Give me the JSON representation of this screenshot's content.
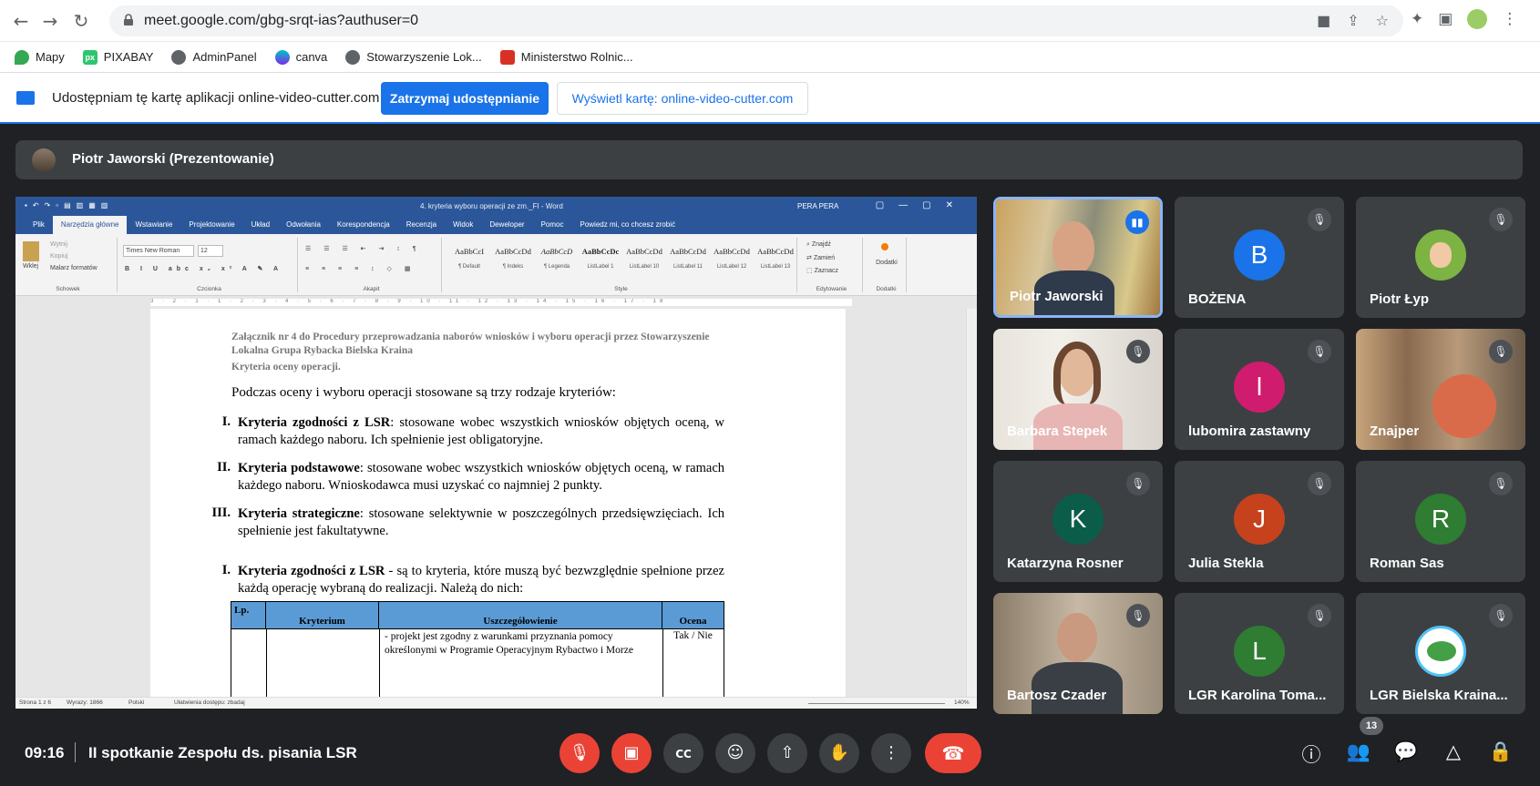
{
  "browser": {
    "url": "meet.google.com/gbg-srqt-ias?authuser=0",
    "bookmarks": [
      {
        "label": "Mapy",
        "color": "#34a853"
      },
      {
        "label": "PIXABAY",
        "color": "#2ec66d",
        "icon_text": "px"
      },
      {
        "label": "AdminPanel",
        "color": "#5f6368"
      },
      {
        "label": "canva",
        "color": "#7d2ae8"
      },
      {
        "label": "Stowarzyszenie Lok...",
        "color": "#5f6368"
      },
      {
        "label": "Ministerstwo Rolnic...",
        "color": "#d93025"
      }
    ]
  },
  "share_bar": {
    "text": "Udostępniam tę kartę aplikacji online-video-cutter.com",
    "stop_label": "Zatrzymaj udostępnianie",
    "show_label": "Wyświetl kartę: online-video-cutter.com"
  },
  "presenter": {
    "name": "Piotr Jaworski (Prezentowanie)"
  },
  "word": {
    "doc_title": "4. kryteria wyboru operacji ze zm._FI  -  Word",
    "user": "PERA PERA",
    "tabs": [
      "Plik",
      "Narzędzia główne",
      "Wstawianie",
      "Projektowanie",
      "Układ",
      "Odwołania",
      "Korespondencja",
      "Recenzja",
      "Widok",
      "Deweloper",
      "Pomoc",
      "Powiedz mi, co chcesz zrobić"
    ],
    "active_tab": "Narzędzia główne",
    "clipboard": {
      "paste": "Wklej",
      "cut": "Wytnij",
      "copy": "Kopiuj",
      "painter": "Malarz formatów",
      "label": "Schowek"
    },
    "font": {
      "name": "Times New Roman",
      "size": "12",
      "label": "Czcionka"
    },
    "paragraph_label": "Akapit",
    "styles": [
      {
        "preview": "AaBbCcI",
        "name": "¶ Default"
      },
      {
        "preview": "AaBbCcDd",
        "name": "¶ Indeks"
      },
      {
        "preview": "AaBbCcD",
        "name": "¶ Legenda"
      },
      {
        "preview": "AaBbCcDc",
        "name": "ListLabel 1"
      },
      {
        "preview": "AaBbCcDd",
        "name": "ListLabel 10"
      },
      {
        "preview": "AaBbCcDd",
        "name": "ListLabel 11"
      },
      {
        "preview": "AaBbCcDd",
        "name": "ListLabel 12"
      },
      {
        "preview": "AaBbCcDd",
        "name": "ListLabel 13"
      }
    ],
    "styles_label": "Style",
    "editing": {
      "find": "Znajdź",
      "replace": "Zamień",
      "select": "Zaznacz",
      "label": "Edytowanie"
    },
    "addins": {
      "name": "Dodatki",
      "label": "Dodatki"
    },
    "ruler_text": "3 · 2 · 1 · 1 · 2 · 3 · 4 · 5 · 6 · 7 · 8 · 9 · 10 · 11 · 12 · 13 · 14 · 15 · 16 · 17 · 18",
    "status": {
      "page": "Strona 1 z 6",
      "words": "Wyrazy: 1866",
      "lang": "Polski",
      "access": "Ułatwienia dostępu: zbadaj",
      "zoom": "140%"
    },
    "document": {
      "header1": "Załącznik nr 4 do Procedury przeprowadzania naborów wniosków i wyboru operacji przez Stowarzyszenie Lokalna Grupa Rybacka Bielska Kraina",
      "header2": "Kryteria oceny operacji.",
      "intro": "Podczas oceny i wyboru operacji stosowane są trzy rodzaje kryteriów:",
      "items": [
        {
          "num": "I.",
          "bold": "Kryteria zgodności z LSR",
          "text": ": stosowane wobec wszystkich wniosków objętych oceną, w ramach każdego naboru. Ich spełnienie jest obligatoryjne."
        },
        {
          "num": "II.",
          "bold": "Kryteria podstawowe",
          "text": ": stosowane wobec wszystkich wniosków objętych oceną, w ramach każdego naboru. Wnioskodawca musi uzyskać co najmniej 2 punkty."
        },
        {
          "num": "III.",
          "bold": "Kryteria strategiczne",
          "text": ": stosowane selektywnie w poszczególnych przedsięwzięciach. Ich spełnienie jest fakultatywne."
        }
      ],
      "section": {
        "num": "I.",
        "bold": "Kryteria zgodności z LSR",
        "text": " - są to kryteria, które muszą być bezwzględnie spełnione przez każdą operację wybraną do realizacji. Należą do nich:"
      },
      "table": {
        "headers": [
          "Lp.",
          "Kryterium",
          "Uszczegółowienie",
          "Ocena"
        ],
        "row1_detail": "- projekt jest zgodny z warunkami przyznania pomocy określonymi w Programie Operacyjnym Rybactwo i Morze",
        "row1_score": "Tak / Nie"
      }
    }
  },
  "participants": [
    {
      "name": "Piotr Jaworski",
      "type": "video",
      "speaking": true
    },
    {
      "name": "BOŻENA",
      "type": "letter",
      "letter": "B",
      "color": "#1a73e8"
    },
    {
      "name": "Piotr Łyp",
      "type": "picture"
    },
    {
      "name": "Barbara Stepek",
      "type": "video"
    },
    {
      "name": "lubomira zastawny",
      "type": "letter",
      "letter": "l",
      "color": "#d01c6e"
    },
    {
      "name": "Znajper",
      "type": "video"
    },
    {
      "name": "Katarzyna Rosner",
      "type": "letter",
      "letter": "K",
      "color": "#0b5d4a"
    },
    {
      "name": "Julia Stekla",
      "type": "letter",
      "letter": "J",
      "color": "#c5421d"
    },
    {
      "name": "Roman Sas",
      "type": "letter",
      "letter": "R",
      "color": "#2e7d32"
    },
    {
      "name": "Bartosz Czader",
      "type": "video"
    },
    {
      "name": "LGR Karolina Toma...",
      "type": "letter",
      "letter": "L",
      "color": "#2e7d32"
    },
    {
      "name": "LGR Bielska Kraina...",
      "type": "picture"
    }
  ],
  "meeting": {
    "time": "09:16",
    "title": "II spotkanie Zespołu ds. pisania LSR",
    "people_count": "13",
    "colors": {
      "danger": "#ea4335",
      "primary": "#1a73e8",
      "surface": "#3c4043"
    }
  }
}
